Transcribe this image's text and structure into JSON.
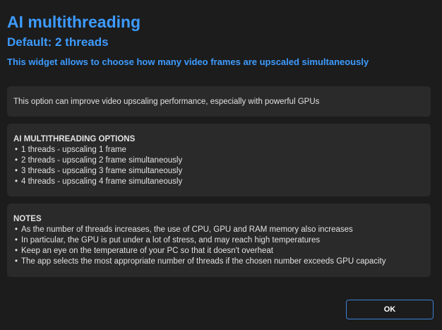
{
  "dialog": {
    "title": "AI multithreading",
    "subtitle": "Default: 2 threads",
    "description": "This widget allows to choose how many video frames are upscaled simultaneously"
  },
  "info_card": {
    "text": "This option can improve video upscaling performance, especially with powerful GPUs"
  },
  "options_card": {
    "heading": "AI MULTITHREADING OPTIONS",
    "bullet": "•",
    "items": [
      "1 threads - upscaling 1 frame",
      "2 threads - upscaling 2 frame simultaneously",
      "3 threads - upscaling 3 frame simultaneously",
      "4 threads - upscaling 4 frame simultaneously"
    ]
  },
  "notes_card": {
    "heading": "NOTES",
    "bullet": "•",
    "items": [
      "As the number of threads increases, the use of CPU, GPU and RAM memory also increases",
      "In particular, the GPU is put under a lot of stress, and may reach high temperatures",
      "Keep an eye on the temperature of your PC so that it doesn't overheat",
      "The app selects the most appropriate number of threads if the chosen number exceeds GPU capacity"
    ]
  },
  "footer": {
    "ok_label": "OK"
  },
  "colors": {
    "background": "#1c1c1c",
    "card": "#2a2a2a",
    "accent": "#3d9bff",
    "button_border": "#3d7fd6",
    "text": "#e2e2e2"
  }
}
